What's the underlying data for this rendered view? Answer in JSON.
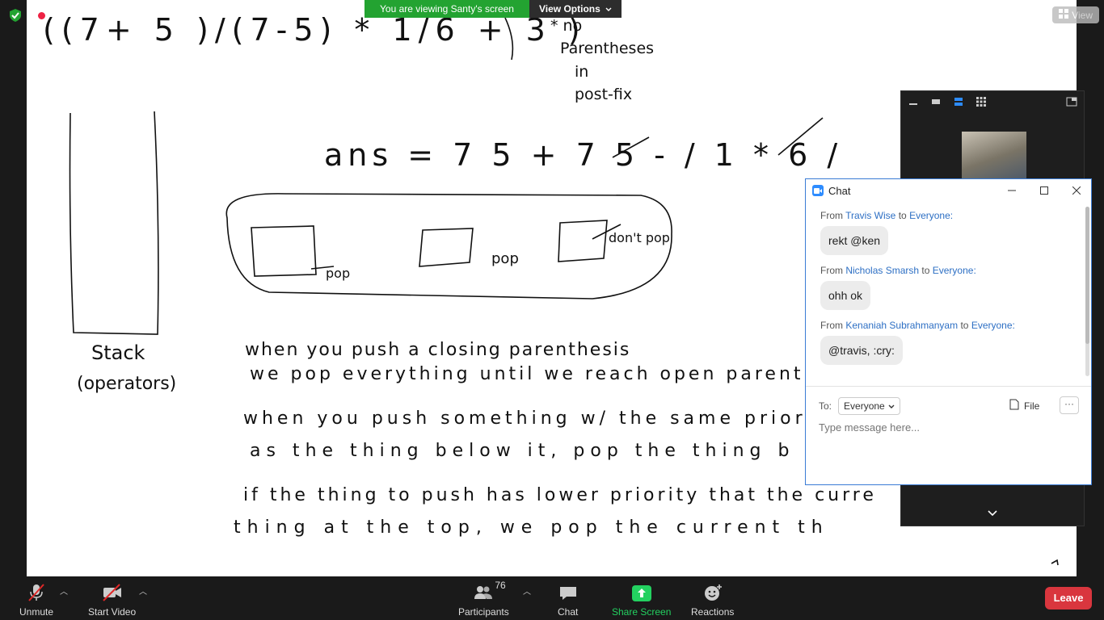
{
  "banner": {
    "viewing_text": "You are viewing Santy's screen",
    "view_options_label": "View Options"
  },
  "view_button_label": "View",
  "whiteboard": {
    "expression": "((7+ 5 )/(7-5) * 1/6 + 3 )",
    "side_note": [
      "* no",
      "Parentheses",
      "in",
      "post-fix"
    ],
    "answer": "ans = 7 5 + 7 5 - / 1 * 6 /",
    "stack_label": [
      "Stack",
      "(operators)"
    ],
    "pop_labels": [
      "pop",
      "pop",
      "don't pop"
    ],
    "rules": [
      [
        "when you push a closing parenthesis",
        "we pop everything until we reach open parent."
      ],
      [
        "when you push something w/ the same priority",
        "as the thing below it, pop the thing b"
      ],
      [
        "if the thing to push has lower priority that the curre",
        "thing at the top, we pop the current th"
      ]
    ]
  },
  "chat": {
    "title": "Chat",
    "messages": [
      {
        "from_prefix": "From",
        "sender": "Travis Wise",
        "to_word": "to",
        "recipient": "Everyone:",
        "text": "rekt @ken"
      },
      {
        "from_prefix": "From",
        "sender": "Nicholas Smarsh",
        "to_word": "to",
        "recipient": "Everyone:",
        "text": "ohh ok"
      },
      {
        "from_prefix": "From",
        "sender": "Kenaniah Subrahmanyam",
        "to_word": "to",
        "recipient": "Everyone:",
        "text": "@travis, :cry:"
      }
    ],
    "to_label": "To:",
    "to_value": "Everyone",
    "file_label": "File",
    "more_label": "···",
    "input_placeholder": "Type message here..."
  },
  "toolbar": {
    "unmute_label": "Unmute",
    "start_video_label": "Start Video",
    "participants_label": "Participants",
    "participants_count": "76",
    "chat_label": "Chat",
    "share_screen_label": "Share Screen",
    "reactions_label": "Reactions",
    "leave_label": "Leave",
    "share_color": "#23d160",
    "leave_color": "#d9363e"
  }
}
